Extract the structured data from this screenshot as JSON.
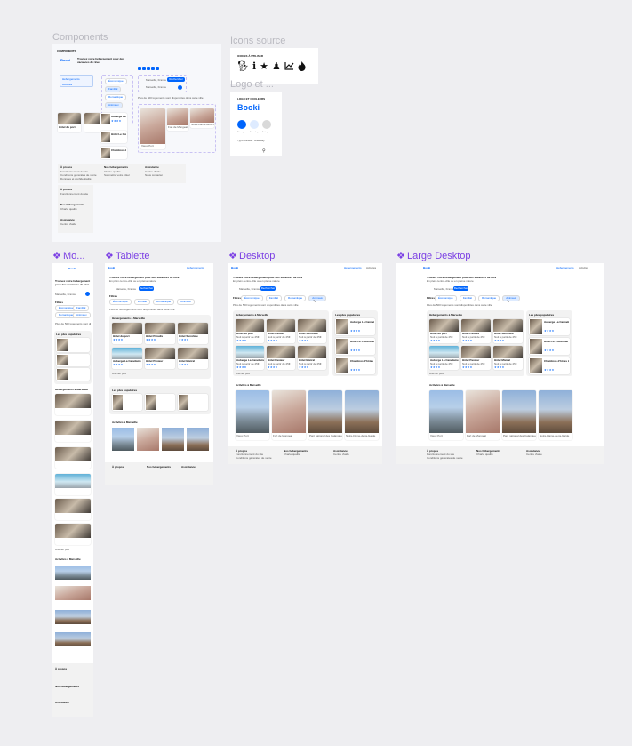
{
  "labels": {
    "components": "Components",
    "icons_source": "Icons source",
    "logo": "Logo et ...",
    "mobile": "Mo...",
    "tablet": "Tablette",
    "desktop": "Desktop",
    "large_desktop": "Large Desktop"
  },
  "colors": {
    "variant_purple": "#7b3fe4",
    "brand_blue": "#0065fc",
    "canvas": "#eeeef1"
  },
  "site": {
    "brand": "Booki",
    "headline": "Trouvez votre hébergement pour des vacances de rêve",
    "subheadline": "En plein centre-ville ou en pleine nature",
    "search_value": "Marseille, France",
    "search_button": "Rechercher",
    "nav_items": [
      "Hébergements",
      "Activités"
    ],
    "filter_label": "Filtres",
    "filters": [
      "Économique",
      "Familial",
      "Romantique",
      "Animaux"
    ],
    "results_notice": "Plus de 500 logements sont disponibles dans cette ville",
    "section_hebergements": "Hébergements à Marseille",
    "section_populaires": "Les plus populaires",
    "section_activites": "Activités à Marseille",
    "show_more": "Afficher plus",
    "price_label": "Nuit à partir de 25€",
    "hotels": [
      "Hôtel du port",
      "Hôtel Paradis",
      "Hôtel Sunshine",
      "Auberge La Canebière",
      "Hôtel Pasteur",
      "Hôtel Mistral"
    ],
    "popular_hotels": [
      "Auberge La Cannebière",
      "Hôtel Le Colombier",
      "Chambres d'hôtes Les Amis"
    ],
    "activities": [
      "Vieux Port",
      "Fort de Mongeat",
      "Parc national des Calanques",
      "Notre-Dame-de-la-Garde"
    ],
    "footer_columns": [
      {
        "title": "À propos",
        "items": [
          "Fonctionnement du site",
          "Conditions générales de vente",
          "Données et confidentialité"
        ]
      },
      {
        "title": "Nos hébergements",
        "items": [
          "Charte qualité",
          "Soumettre votre hôtel"
        ]
      },
      {
        "title": "Assistance",
        "items": [
          "Centre d'aide",
          "Nous contacter"
        ]
      }
    ]
  },
  "components_panel": {
    "title": "COMPONENTS",
    "icons_title": "ICONES À UTILISER",
    "logo_title": "LOGO ET COULEURS",
    "palette_names": [
      "Primary",
      "Secondary",
      "Tertiary"
    ],
    "palette_colors": [
      "#0065fc",
      "#deebff",
      "#d9d9d9"
    ],
    "typo_label": "Typo utilisée : Raleway",
    "icon_names": [
      "dog-icon",
      "info-icon",
      "star-icon",
      "person-icon",
      "chart-line-icon",
      "fire-icon"
    ]
  }
}
